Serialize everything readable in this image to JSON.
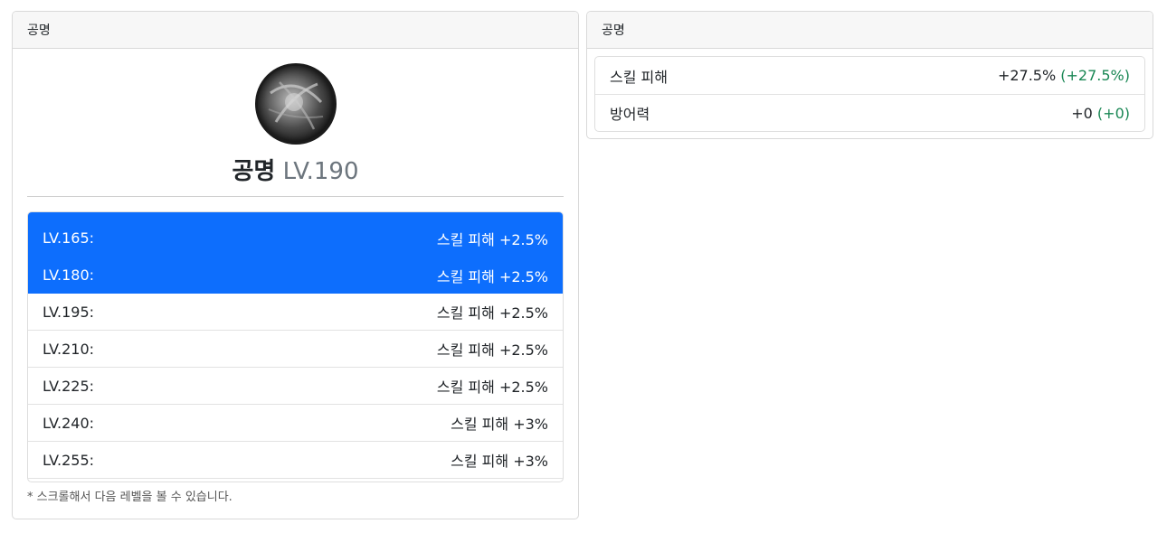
{
  "left_panel": {
    "header": "공명",
    "emblem_icon": "resonance-emblem-icon",
    "title_name": "공명",
    "title_level": "LV.190",
    "levels": [
      {
        "level": "LV.165:",
        "effect": "스킬 피해 +2.5%",
        "active": true
      },
      {
        "level": "LV.180:",
        "effect": "스킬 피해 +2.5%",
        "active": true
      },
      {
        "level": "LV.195:",
        "effect": "스킬 피해 +2.5%",
        "active": false
      },
      {
        "level": "LV.210:",
        "effect": "스킬 피해 +2.5%",
        "active": false
      },
      {
        "level": "LV.225:",
        "effect": "스킬 피해 +2.5%",
        "active": false
      },
      {
        "level": "LV.240:",
        "effect": "스킬 피해 +3%",
        "active": false
      },
      {
        "level": "LV.255:",
        "effect": "스킬 피해 +3%",
        "active": false
      }
    ],
    "scroll_note": "* 스크롤해서 다음 레벨을 볼 수 있습니다."
  },
  "right_panel": {
    "header": "공명",
    "stats": [
      {
        "label": "스킬 피해",
        "value": "+27.5%",
        "delta": "(+27.5%)"
      },
      {
        "label": "방어력",
        "value": "+0",
        "delta": "(+0)"
      }
    ]
  },
  "colors": {
    "active_bg": "#0d6efd",
    "delta_green": "#198754",
    "header_bg": "#f7f7f7"
  }
}
